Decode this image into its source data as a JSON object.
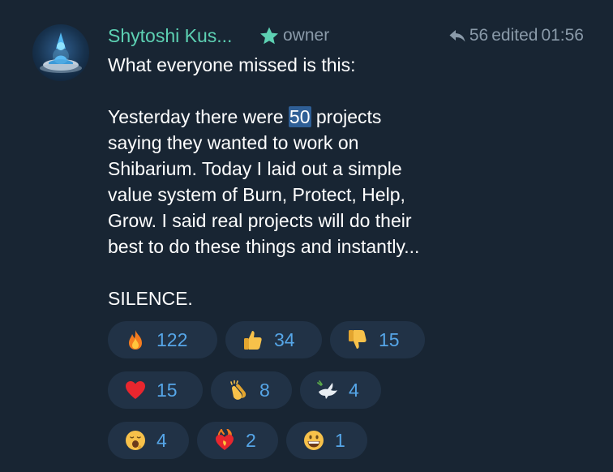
{
  "message": {
    "sender_name": "Shytoshi Kus...",
    "sender_role": "owner",
    "reply_count": "56",
    "edited_label": "edited",
    "time": "01:56",
    "paragraphs": {
      "p1": "What everyone missed is this:",
      "p2_before": "Yesterday there were ",
      "p2_highlight": "50",
      "p2_after": " projects",
      "p2_line2": "saying they wanted to work on",
      "p2_line3": "Shibarium. Today I laid out a simple",
      "p2_line4": "value system of Burn, Protect,  Help,",
      "p2_line5": "Grow. I said real projects will do their",
      "p2_line6": "best to do these things and instantly...",
      "p3": "SILENCE."
    }
  },
  "icons": {
    "avatar": "meditating-figure-avatar",
    "role_badge": "star-icon",
    "replies": "reply-arrow-icon"
  },
  "colors": {
    "background": "#182533",
    "sender_name": "#5dd1b3",
    "meta_text": "#8a9aa9",
    "reaction_bg": "#213246",
    "reaction_count": "#56a6e8",
    "highlight": "#2f5f96"
  },
  "reactions": [
    {
      "icon": "fire-emoji",
      "count": "122"
    },
    {
      "icon": "thumbs-up-emoji",
      "count": "34"
    },
    {
      "icon": "thumbs-down-emoji",
      "count": "15"
    },
    {
      "icon": "red-heart-emoji",
      "count": "15"
    },
    {
      "icon": "clapping-hands-emoji",
      "count": "8"
    },
    {
      "icon": "dove-emoji",
      "count": "4"
    },
    {
      "icon": "yawning-face-emoji",
      "count": "4"
    },
    {
      "icon": "heart-on-fire-emoji",
      "count": "2"
    },
    {
      "icon": "grinning-face-emoji",
      "count": "1"
    }
  ]
}
